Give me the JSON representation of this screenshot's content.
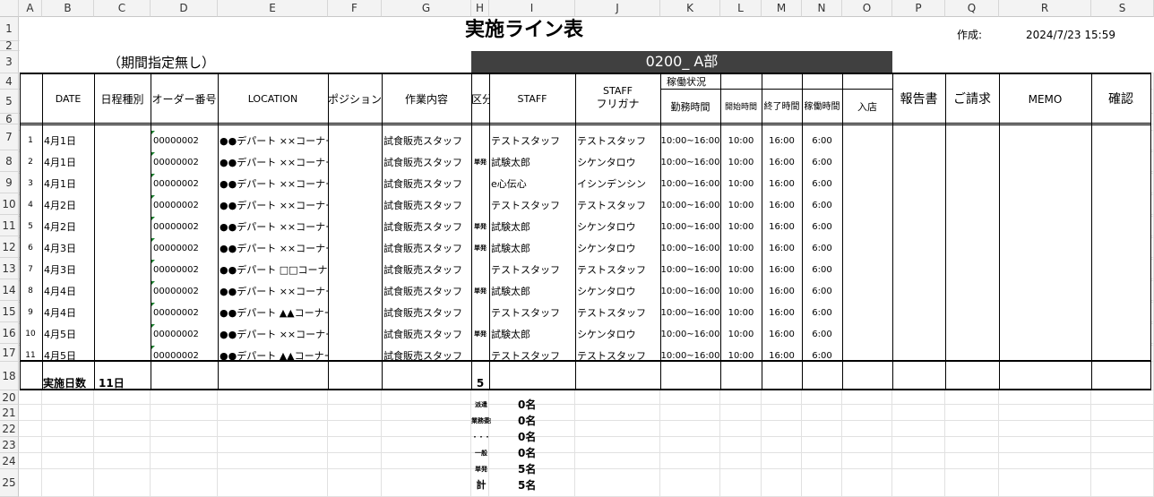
{
  "columns": [
    "A",
    "B",
    "C",
    "D",
    "E",
    "F",
    "G",
    "H",
    "I",
    "J",
    "K",
    "L",
    "M",
    "N",
    "O",
    "P",
    "Q",
    "R",
    "S"
  ],
  "rows": [
    "1",
    "2",
    "3",
    "4",
    "5",
    "6",
    "7",
    "8",
    "9",
    "10",
    "11",
    "12",
    "13",
    "14",
    "15",
    "16",
    "17",
    "18",
    "20",
    "21",
    "22",
    "23",
    "24",
    "25"
  ],
  "title": "実施ライン表",
  "created_label": "作成:",
  "created_value": "2024/7/23 15:59",
  "period_note": "（期間指定無し）",
  "dept_banner": "0200_ A部",
  "headers": {
    "date": "DATE",
    "schedule_type": "日程種別",
    "order_no": "オーダー番号",
    "location": "LOCATION",
    "position": "ポジション",
    "work": "作業内容",
    "kubun": "区分",
    "staff": "STAFF",
    "staff_kana_1": "STAFF",
    "staff_kana_2": "フリガナ",
    "status_group": "稼働状況",
    "work_hours": "勤務時間",
    "start_time": "開始時間",
    "end_time": "終了時間",
    "operating_time": "稼働時間",
    "entry": "入店",
    "report": "報告書",
    "invoice": "ご請求",
    "memo": "MEMO",
    "confirm": "確認"
  },
  "records": [
    {
      "no": "1",
      "date": "4月1日",
      "order": "00000002",
      "location": "●●デパート ××コーナー",
      "work": "試食販売スタッフ",
      "kubun": "",
      "staff": "テストスタッフ",
      "kana": "テストスタッフ",
      "hours": "10:00~16:00",
      "start": "10:00",
      "end": "16:00",
      "op": "6:00"
    },
    {
      "no": "2",
      "date": "4月1日",
      "order": "00000002",
      "location": "●●デパート ××コーナー",
      "work": "試食販売スタッフ",
      "kubun": "単発",
      "staff": "試験太郎",
      "kana": "シケンタロウ",
      "hours": "10:00~16:00",
      "start": "10:00",
      "end": "16:00",
      "op": "6:00"
    },
    {
      "no": "3",
      "date": "4月1日",
      "order": "00000002",
      "location": "●●デパート ××コーナー",
      "work": "試食販売スタッフ",
      "kubun": "",
      "staff": "e心伝心",
      "kana": "イシンデンシン",
      "hours": "10:00~16:00",
      "start": "10:00",
      "end": "16:00",
      "op": "6:00"
    },
    {
      "no": "4",
      "date": "4月2日",
      "order": "00000002",
      "location": "●●デパート ××コーナー",
      "work": "試食販売スタッフ",
      "kubun": "",
      "staff": "テストスタッフ",
      "kana": "テストスタッフ",
      "hours": "10:00~16:00",
      "start": "10:00",
      "end": "16:00",
      "op": "6:00"
    },
    {
      "no": "5",
      "date": "4月2日",
      "order": "00000002",
      "location": "●●デパート ××コーナー",
      "work": "試食販売スタッフ",
      "kubun": "単発",
      "staff": "試験太郎",
      "kana": "シケンタロウ",
      "hours": "10:00~16:00",
      "start": "10:00",
      "end": "16:00",
      "op": "6:00"
    },
    {
      "no": "6",
      "date": "4月3日",
      "order": "00000002",
      "location": "●●デパート ××コーナー",
      "work": "試食販売スタッフ",
      "kubun": "単発",
      "staff": "試験太郎",
      "kana": "シケンタロウ",
      "hours": "10:00~16:00",
      "start": "10:00",
      "end": "16:00",
      "op": "6:00"
    },
    {
      "no": "7",
      "date": "4月3日",
      "order": "00000002",
      "location": "●●デパート □□コーナー",
      "work": "試食販売スタッフ",
      "kubun": "",
      "staff": "テストスタッフ",
      "kana": "テストスタッフ",
      "hours": "10:00~16:00",
      "start": "10:00",
      "end": "16:00",
      "op": "6:00"
    },
    {
      "no": "8",
      "date": "4月4日",
      "order": "00000002",
      "location": "●●デパート ××コーナー",
      "work": "試食販売スタッフ",
      "kubun": "単発",
      "staff": "試験太郎",
      "kana": "シケンタロウ",
      "hours": "10:00~16:00",
      "start": "10:00",
      "end": "16:00",
      "op": "6:00"
    },
    {
      "no": "9",
      "date": "4月4日",
      "order": "00000002",
      "location": "●●デパート ▲▲コーナー",
      "work": "試食販売スタッフ",
      "kubun": "",
      "staff": "テストスタッフ",
      "kana": "テストスタッフ",
      "hours": "10:00~16:00",
      "start": "10:00",
      "end": "16:00",
      "op": "6:00"
    },
    {
      "no": "10",
      "date": "4月5日",
      "order": "00000002",
      "location": "●●デパート ××コーナー",
      "work": "試食販売スタッフ",
      "kubun": "単発",
      "staff": "試験太郎",
      "kana": "シケンタロウ",
      "hours": "10:00~16:00",
      "start": "10:00",
      "end": "16:00",
      "op": "6:00"
    },
    {
      "no": "11",
      "date": "4月5日",
      "order": "00000002",
      "location": "●●デパート ▲▲コーナー",
      "work": "試食販売スタッフ",
      "kubun": "",
      "staff": "テストスタッフ",
      "kana": "テストスタッフ",
      "hours": "10:00~16:00",
      "start": "10:00",
      "end": "16:00",
      "op": "6:00"
    }
  ],
  "footer": {
    "days_label": "実施日数",
    "days_value": "11日",
    "kubun_count": "5"
  },
  "summary": [
    {
      "label": "派遣",
      "value": "0名"
    },
    {
      "label": "業務委託",
      "value": "0名"
    },
    {
      "label": "・・・",
      "value": "0名"
    },
    {
      "label": "一般",
      "value": "0名"
    },
    {
      "label": "単発",
      "value": "5名"
    },
    {
      "label": "計",
      "value": "5名"
    }
  ]
}
